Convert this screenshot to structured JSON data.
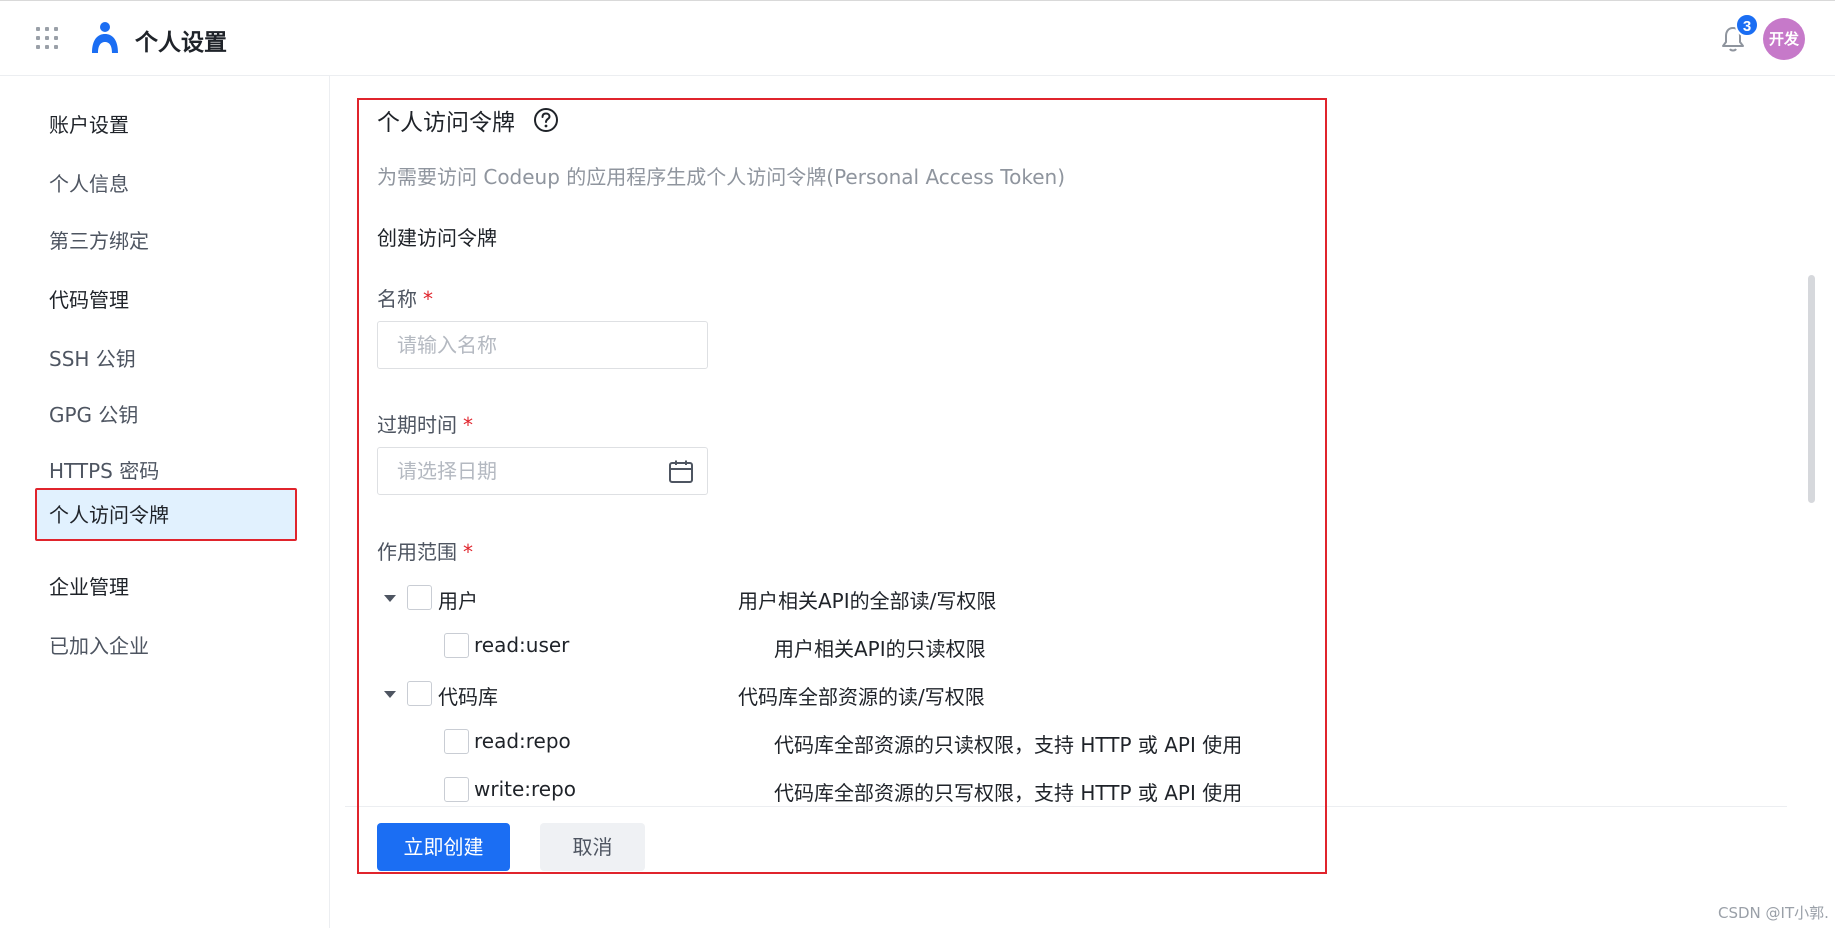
{
  "header": {
    "app_title": "个人设置",
    "menu_icon": "grid-menu-icon",
    "logo_icon": "user-profile-logo-icon",
    "notifications_icon": "bell-icon",
    "notification_count": "3",
    "avatar_text": "开发",
    "accent_color": "#1b6ef3",
    "avatar_color": "#c679c9"
  },
  "sidebar": {
    "items": [
      {
        "label": "账户设置"
      },
      {
        "label": "个人信息"
      },
      {
        "label": "第三方绑定"
      },
      {
        "label": "代码管理"
      },
      {
        "label": "SSH 公钥"
      },
      {
        "label": "GPG 公钥"
      },
      {
        "label": "HTTPS 密码"
      },
      {
        "label": "个人访问令牌",
        "active": true
      },
      {
        "label": "企业管理"
      },
      {
        "label": "已加入企业"
      }
    ]
  },
  "main": {
    "title": "个人访问令牌",
    "help_icon": "question-circle-icon",
    "description": "为需要访问 Codeup 的应用程序生成个人访问令牌(Personal Access Token)",
    "create_heading": "创建访问令牌",
    "name_field": {
      "label": "名称",
      "required_mark": "*",
      "placeholder": "请输入名称",
      "value": ""
    },
    "expiry_field": {
      "label": "过期时间",
      "required_mark": "*",
      "placeholder": "请选择日期",
      "icon": "calendar-icon"
    },
    "scope_field": {
      "label": "作用范围",
      "required_mark": "*",
      "groups": [
        {
          "name": "用户",
          "description": "用户相关API的全部读/写权限",
          "expanded": true,
          "checked": false,
          "children": [
            {
              "name": "read:user",
              "description": "用户相关API的只读权限",
              "checked": false
            }
          ]
        },
        {
          "name": "代码库",
          "description": "代码库全部资源的读/写权限",
          "expanded": true,
          "checked": false,
          "children": [
            {
              "name": "read:repo",
              "description": "代码库全部资源的只读权限，支持 HTTP 或 API 使用",
              "checked": false
            },
            {
              "name": "write:repo",
              "description": "代码库全部资源的只写权限，支持 HTTP 或 API 使用",
              "checked": false
            }
          ]
        }
      ]
    },
    "actions": {
      "create_label": "立即创建",
      "cancel_label": "取消"
    }
  },
  "watermark": "CSDN @IT小郭."
}
